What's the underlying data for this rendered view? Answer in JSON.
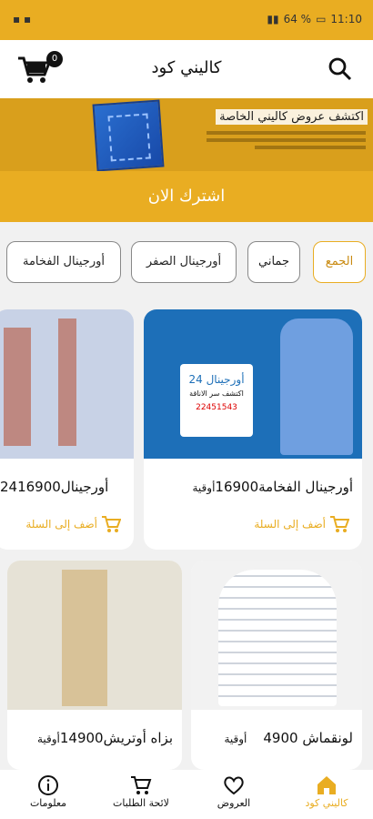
{
  "status": {
    "time": "11:10",
    "battery": "64 %"
  },
  "header": {
    "title": "كاليني كود",
    "cart_count": "0"
  },
  "banner": {
    "headline": "اكتشف عروض كاليني الخاصة"
  },
  "subscribe_label": "اشترك الان",
  "chips": [
    "الجمع",
    "جماني",
    "أورجينال الصفر",
    "أورجينال الفخامة"
  ],
  "products": [
    {
      "name": "أورجينال الفخامة",
      "price": "16900",
      "currency": "أوقية",
      "add_label": "أضف إلى السلة",
      "image_text": "أورجينال 24",
      "image_subtext": "اكتشف سر الاناقة",
      "image_phone": "22451543"
    },
    {
      "name": "أورجينال24",
      "price": "16900",
      "currency": "",
      "add_label": "أضف إلى السلة"
    },
    {
      "name": "لونقماش",
      "price": "4900",
      "currency": "أوقية"
    },
    {
      "name": "بزاه أوتريش",
      "price": "14900",
      "currency": "أوقية"
    }
  ],
  "nav": [
    {
      "label": "كاليني كود",
      "icon": "home-icon",
      "active": true
    },
    {
      "label": "العروض",
      "icon": "heart-icon",
      "active": false
    },
    {
      "label": "لائحة الطلبات",
      "icon": "cart-icon",
      "active": false
    },
    {
      "label": "معلومات",
      "icon": "info-icon",
      "active": false
    }
  ],
  "colors": {
    "accent": "#e9ad22",
    "banner": "#d99f1c"
  }
}
